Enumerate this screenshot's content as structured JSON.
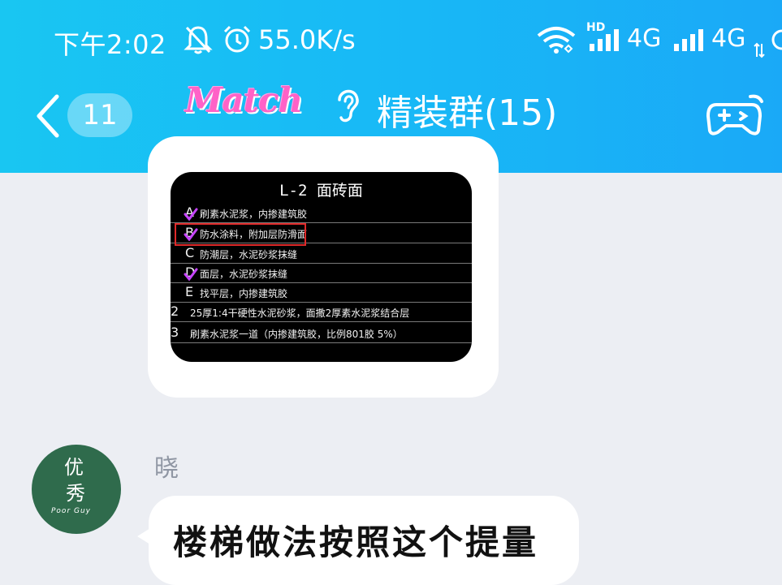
{
  "status_bar": {
    "time": "下午2:02",
    "net_speed": "55.0K/s",
    "hd_label": "HD",
    "network_1": "4G",
    "network_2": "4G",
    "icons": [
      "mute-bell-icon",
      "alarm-icon",
      "wifi-icon",
      "signal-icon",
      "signal-icon"
    ]
  },
  "nav": {
    "unread_count": "11",
    "logo_text": "Match",
    "group_title": "精装群(15)",
    "icons": [
      "back-arrow-icon",
      "ear-icon",
      "gamepad-icon"
    ]
  },
  "image_message": {
    "image": {
      "title": "L-2  面砖面",
      "rows": [
        {
          "letter": "A",
          "text": "刷素水泥浆，内掺建筑胶",
          "checked": true
        },
        {
          "letter": "B",
          "text": "防水涂料，附加层防滑面",
          "checked": true
        },
        {
          "letter": "C",
          "text": "防潮层，水泥砂浆抹缝",
          "checked": false
        },
        {
          "letter": "D",
          "text": "面层，水泥砂浆抹缝",
          "checked": true
        },
        {
          "letter": "E",
          "text": "找平层，内掺建筑胶",
          "checked": false
        },
        {
          "letter": "2",
          "text": "25厚1:4干硬性水泥砂浆，面撒2厚素水泥浆结合层",
          "checked": false
        },
        {
          "letter": "3",
          "text": "刷素水泥浆一道（内掺建筑胶，比例801胶 5%）",
          "checked": false
        }
      ],
      "highlighted_row": 1
    }
  },
  "text_message": {
    "sender": "晓",
    "avatar_lines": [
      "优",
      "秀",
      "Poor Guy"
    ],
    "text": "楼梯做法按照这个提量"
  },
  "colors": {
    "header_start": "#19c6f2",
    "header_end": "#1aa9f7",
    "chat_bg": "#eceef3",
    "avatar_bg": "#2f6b4c",
    "check": "#c744ff",
    "highlight_box": "#e02a2a"
  }
}
